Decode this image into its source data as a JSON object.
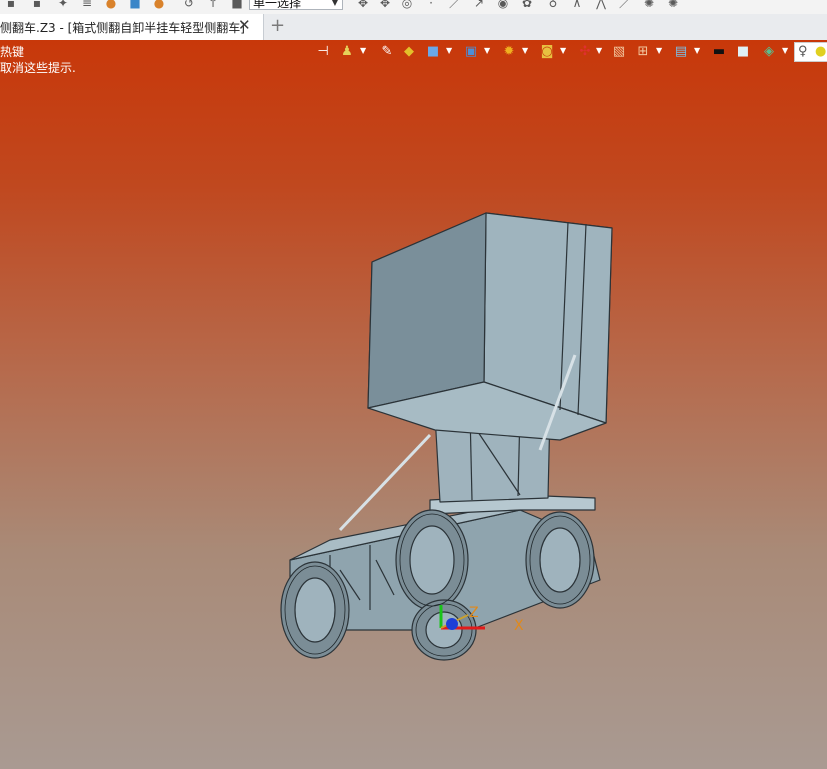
{
  "toolbar": {
    "selection_filter": {
      "value": "单一选择"
    }
  },
  "tab": {
    "label": "侧翻车.Z3 - [箱式侧翻自卸半挂车轻型侧翻车]",
    "close_glyph": "✕",
    "add_glyph": "+"
  },
  "viewport": {
    "hint_line1": "热键",
    "hint_line2": "取消这些提示."
  },
  "triad": {
    "x_label": "X",
    "z_label": "Z"
  },
  "colors": {
    "viewport_top": "#c8380a",
    "viewport_bottom": "#a99a92",
    "model_body": "#9fb3bd",
    "model_edge": "#2b3338"
  }
}
